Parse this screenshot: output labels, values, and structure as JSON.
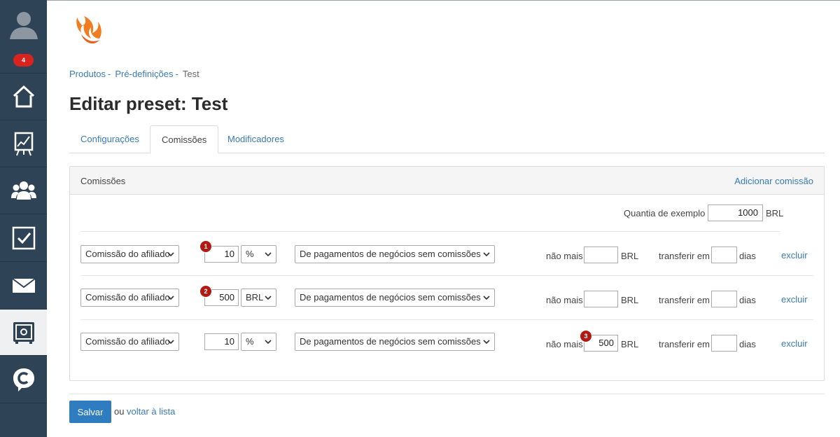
{
  "sidebar": {
    "badge": "4",
    "items": [
      {
        "icon": "user-avatar-icon"
      },
      {
        "icon": "home-icon"
      },
      {
        "icon": "chart-board-icon"
      },
      {
        "icon": "users-group-icon"
      },
      {
        "icon": "checkbox-icon"
      },
      {
        "icon": "mail-icon"
      },
      {
        "icon": "safe-settings-icon",
        "active": true
      },
      {
        "icon": "chat-c-icon"
      }
    ]
  },
  "breadcrumb": {
    "items": [
      "Produtos",
      "Pré-definições"
    ],
    "separator": "-",
    "current": "Test"
  },
  "page_title": "Editar preset: Test",
  "tabs": [
    {
      "label": "Configurações"
    },
    {
      "label": "Comissões",
      "active": true
    },
    {
      "label": "Modificadores"
    }
  ],
  "panel": {
    "title": "Comissões",
    "action": "Adicionar comissão",
    "example_label": "Quantia de exemplo",
    "example_value": "1000",
    "example_currency": "BRL"
  },
  "rows": [
    {
      "type": "Comissão do afiliado",
      "marker": "1",
      "value": "10",
      "unit": "%",
      "source": "De pagamentos de negócios sem comissões",
      "max_label": "não mais",
      "max_value": "",
      "max_currency": "BRL",
      "transfer_label": "transferir em",
      "transfer_value": "",
      "days_label": "dias",
      "delete": "excluir"
    },
    {
      "type": "Comissão do afiliado",
      "marker": "2",
      "value": "500",
      "unit": "BRL",
      "source": "De pagamentos de negócios sem comissões",
      "max_label": "não mais",
      "max_value": "",
      "max_currency": "BRL",
      "transfer_label": "transferir em",
      "transfer_value": "",
      "days_label": "dias",
      "delete": "excluir"
    },
    {
      "type": "Comissão do afiliado",
      "marker": "3",
      "value": "10",
      "unit": "%",
      "source": "De pagamentos de negócios sem comissões",
      "max_label": "não mais",
      "max_value": "500",
      "max_currency": "BRL",
      "transfer_label": "transferir em",
      "transfer_value": "",
      "days_label": "dias",
      "delete": "excluir"
    }
  ],
  "footer": {
    "save": "Salvar",
    "or": "ou",
    "back": "voltar à lista"
  },
  "colors": {
    "sidebar": "#2e4356",
    "accent": "#2f7dc0",
    "link": "#3a7bb3",
    "badge": "#d9231e",
    "logo": "#f07b21"
  }
}
